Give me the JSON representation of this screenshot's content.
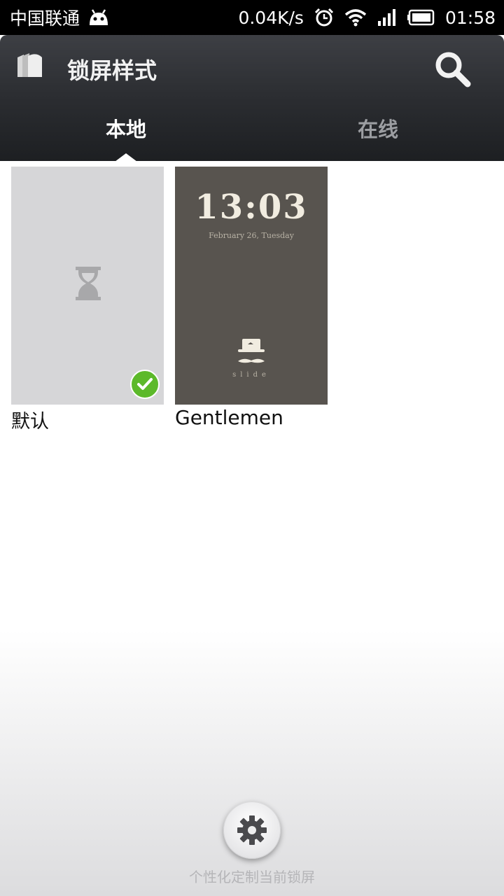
{
  "status_bar": {
    "carrier": "中国联通",
    "net_speed": "0.04K/s",
    "time": "01:58"
  },
  "header": {
    "title": "锁屏样式"
  },
  "tabs": [
    {
      "label": "本地",
      "active": true
    },
    {
      "label": "在线",
      "active": false
    }
  ],
  "items": [
    {
      "label": "默认",
      "selected": true
    },
    {
      "label": "Gentlemen",
      "selected": false,
      "preview": {
        "time": "13:03",
        "date": "February 26, Tuesday",
        "hint": "slide"
      }
    }
  ],
  "footer": {
    "caption": "个性化定制当前锁屏"
  },
  "colors": {
    "accent_check": "#5cb92a",
    "header_bg": "#2b2d31"
  }
}
